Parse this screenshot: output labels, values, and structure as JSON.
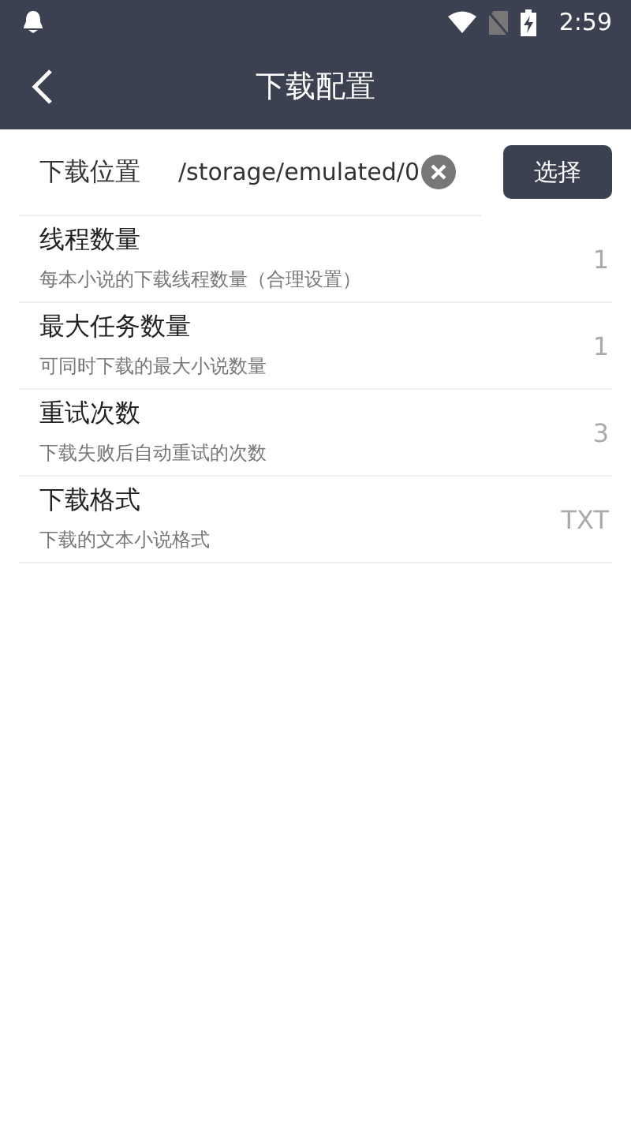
{
  "status_bar": {
    "time": "2:59"
  },
  "header": {
    "title": "下载配置"
  },
  "location": {
    "label": "下载位置",
    "value": "/storage/emulated/0",
    "button": "选择"
  },
  "settings": [
    {
      "title": "线程数量",
      "description": "每本小说的下载线程数量（合理设置）",
      "value": "1"
    },
    {
      "title": "最大任务数量",
      "description": "可同时下载的最大小说数量",
      "value": "1"
    },
    {
      "title": "重试次数",
      "description": "下载失败后自动重试的次数",
      "value": "3"
    },
    {
      "title": "下载格式",
      "description": "下载的文本小说格式",
      "value": "TXT"
    }
  ]
}
